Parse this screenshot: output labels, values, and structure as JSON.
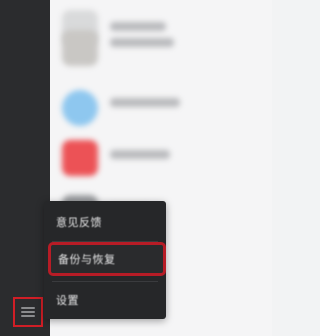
{
  "menu": {
    "items": [
      {
        "label": "意见反馈"
      },
      {
        "label": "备份与恢复"
      },
      {
        "label": "设置"
      }
    ]
  },
  "colors": {
    "sidebar": "#2b2c2e",
    "menu_bg": "#262729",
    "highlight": "#d01e26",
    "avatar_1": "#d9dadb",
    "avatar_2": "#c9c7c4",
    "avatar_3": "#8ec7ef",
    "avatar_4": "#ec5256",
    "avatar_5": "#9a9c9f"
  },
  "icons": {
    "sidebar_button": "menu-icon"
  }
}
